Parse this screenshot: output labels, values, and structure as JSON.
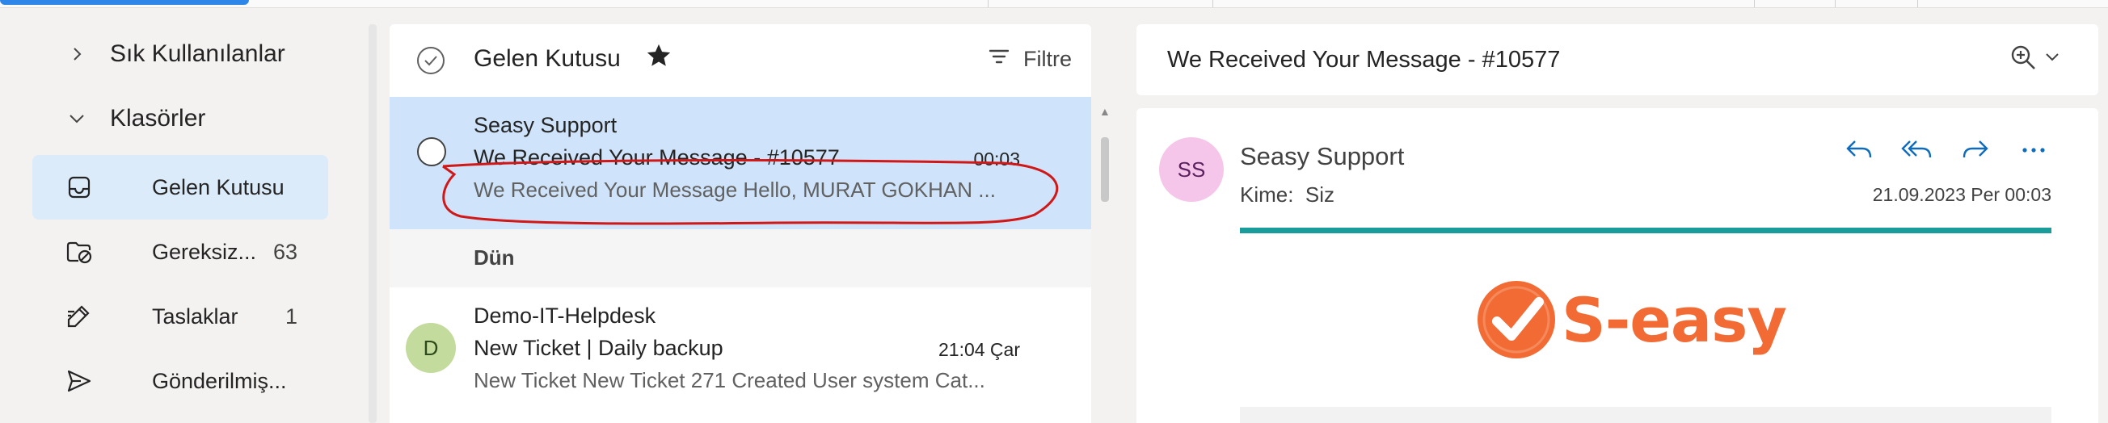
{
  "nav": {
    "favorites_label": "Sık Kullanılanlar",
    "folders_label": "Klasörler",
    "items": [
      {
        "label": "Gelen Kutusu",
        "count": ""
      },
      {
        "label": "Gereksiz...",
        "count": "63"
      },
      {
        "label": "Taslaklar",
        "count": "1"
      },
      {
        "label": "Gönderilmiş...",
        "count": ""
      }
    ]
  },
  "list": {
    "title": "Gelen Kutusu",
    "filter_label": "Filtre",
    "messages": [
      {
        "sender": "Seasy Support",
        "subject": "We Received Your Message - #10577",
        "time": "00:03",
        "preview": "We Received Your Message Hello, MURAT GOKHAN ..."
      },
      {
        "sender": "Demo-IT-Helpdesk",
        "subject": "New Ticket | Daily backup",
        "time": "21:04 Çar",
        "preview": "New Ticket New Ticket 271 Created User system Cat...",
        "avatar": "D"
      }
    ],
    "group_label": "Dün"
  },
  "reading": {
    "title": "We Received Your Message - #10577",
    "avatar": "SS",
    "sender": "Seasy Support",
    "to_label": "Kime:",
    "to_value": "Siz",
    "date": "21.09.2023 Per 00:03",
    "logo_text": "S-easy"
  },
  "colors": {
    "accent": "#0f6cbd",
    "selected_bg": "#cfe4fa",
    "brand_orange": "#f26b34",
    "teal_bar": "#1a9c9a",
    "annotation_red": "#d01818"
  }
}
